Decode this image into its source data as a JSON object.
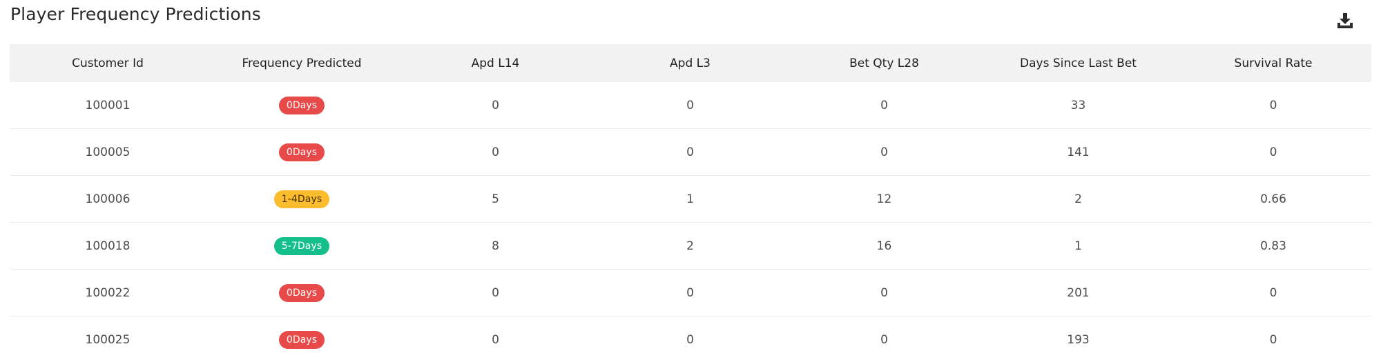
{
  "page": {
    "title": "Player Frequency Predictions"
  },
  "toolbar": {
    "download_icon": "download-icon"
  },
  "table": {
    "columns": [
      "Customer Id",
      "Frequency Predicted",
      "Apd L14",
      "Apd L3",
      "Bet Qty L28",
      "Days Since Last Bet",
      "Survival Rate"
    ],
    "rows": [
      {
        "customer_id": "100001",
        "frequency": "0Days",
        "frequency_status": "red",
        "apd_l14": "0",
        "apd_l3": "0",
        "bet_qty_l28": "0",
        "days_since_last_bet": "33",
        "survival_rate": "0"
      },
      {
        "customer_id": "100005",
        "frequency": "0Days",
        "frequency_status": "red",
        "apd_l14": "0",
        "apd_l3": "0",
        "bet_qty_l28": "0",
        "days_since_last_bet": "141",
        "survival_rate": "0"
      },
      {
        "customer_id": "100006",
        "frequency": "1-4Days",
        "frequency_status": "yellow",
        "apd_l14": "5",
        "apd_l3": "1",
        "bet_qty_l28": "12",
        "days_since_last_bet": "2",
        "survival_rate": "0.66"
      },
      {
        "customer_id": "100018",
        "frequency": "5-7Days",
        "frequency_status": "green",
        "apd_l14": "8",
        "apd_l3": "2",
        "bet_qty_l28": "16",
        "days_since_last_bet": "1",
        "survival_rate": "0.83"
      },
      {
        "customer_id": "100022",
        "frequency": "0Days",
        "frequency_status": "red",
        "apd_l14": "0",
        "apd_l3": "0",
        "bet_qty_l28": "0",
        "days_since_last_bet": "201",
        "survival_rate": "0"
      },
      {
        "customer_id": "100025",
        "frequency": "0Days",
        "frequency_status": "red",
        "apd_l14": "0",
        "apd_l3": "0",
        "bet_qty_l28": "0",
        "days_since_last_bet": "193",
        "survival_rate": "0"
      }
    ]
  },
  "colors": {
    "badge_red": "#e84949",
    "badge_yellow": "#fbbd2e",
    "badge_green": "#14bf8b",
    "header_bg": "#f2f2f2"
  }
}
